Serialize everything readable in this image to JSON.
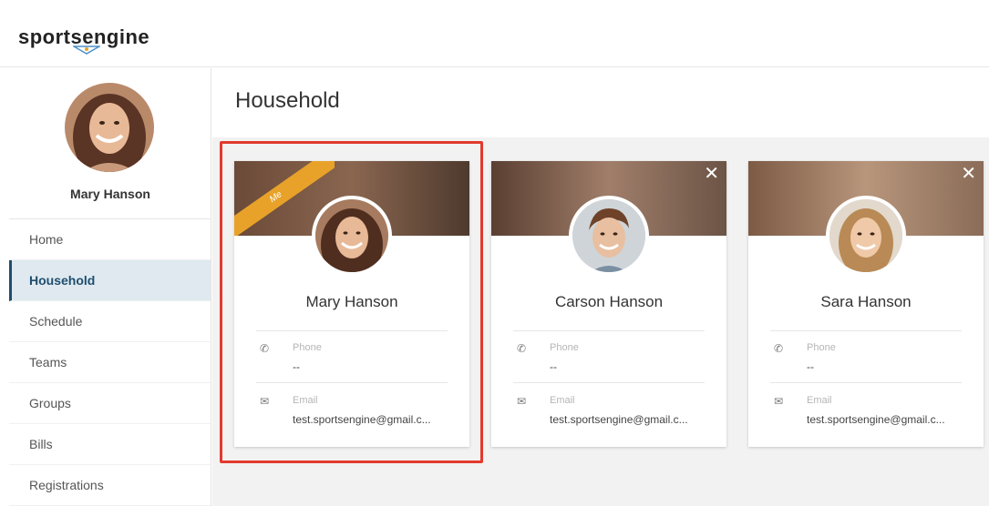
{
  "app": {
    "logo_text_1": "sport",
    "logo_text_2": "s",
    "logo_text_3": "engine"
  },
  "sidebar": {
    "user_name": "Mary Hanson",
    "items": [
      {
        "label": "Home",
        "active": false
      },
      {
        "label": "Household",
        "active": true
      },
      {
        "label": "Schedule",
        "active": false
      },
      {
        "label": "Teams",
        "active": false
      },
      {
        "label": "Groups",
        "active": false
      },
      {
        "label": "Bills",
        "active": false
      },
      {
        "label": "Registrations",
        "active": false
      }
    ]
  },
  "main": {
    "title": "Household",
    "cards": [
      {
        "name": "Mary Hanson",
        "badge": "Me",
        "phone_label": "Phone",
        "phone_value": "--",
        "email_label": "Email",
        "email_value": "test.sportsengine@gmail.c...",
        "close_icon": "close-icon"
      },
      {
        "name": "Carson Hanson",
        "phone_label": "Phone",
        "phone_value": "--",
        "email_label": "Email",
        "email_value": "test.sportsengine@gmail.c...",
        "close_icon": "✕"
      },
      {
        "name": "Sara Hanson",
        "phone_label": "Phone",
        "phone_value": "--",
        "email_label": "Email",
        "email_value": "test.sportsengine@gmail.c...",
        "close_icon": "✕"
      }
    ]
  },
  "colors": {
    "accent": "#1f4e6e",
    "ribbon": "#e8a229",
    "highlight": "#e23a2e"
  }
}
